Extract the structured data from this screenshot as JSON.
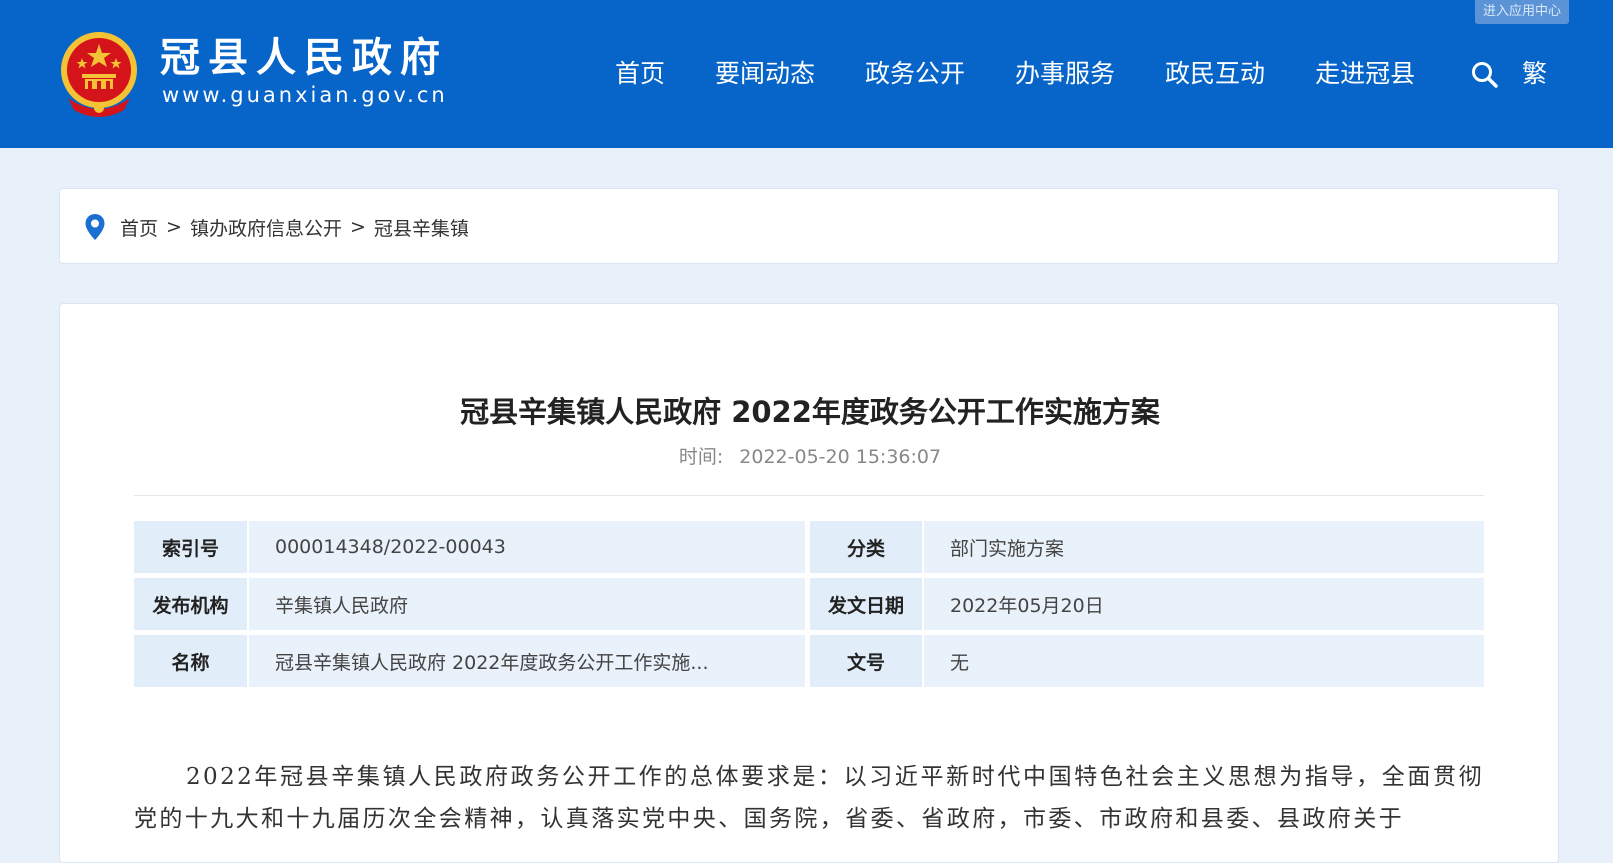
{
  "header": {
    "app_center_label": "进入应用中心",
    "site_title": "冠县人民政府",
    "site_url": "www.guanxian.gov.cn",
    "nav": [
      "首页",
      "要闻动态",
      "政务公开",
      "办事服务",
      "政民互动",
      "走进冠县"
    ],
    "trad_label": "繁",
    "colors": {
      "brand_blue": "#0764c8",
      "emblem_red": "#d4131a",
      "emblem_gold": "#f3c335"
    }
  },
  "breadcrumb": {
    "icon": "location-pin-icon",
    "items": [
      "首页",
      "镇办政府信息公开",
      "冠县辛集镇"
    ],
    "separator": ">"
  },
  "article": {
    "title": "冠县辛集镇人民政府 2022年度政务公开工作实施方案",
    "time_label": "时间:",
    "time_value": "2022-05-20 15:36:07",
    "info": {
      "index_label": "索引号",
      "index_value": "000014348/2022-00043",
      "category_label": "分类",
      "category_value": "部门实施方案",
      "publisher_label": "发布机构",
      "publisher_value": "辛集镇人民政府",
      "date_label": "发文日期",
      "date_value": "2022年05月20日",
      "name_label": "名称",
      "name_value": "冠县辛集镇人民政府 2022年度政务公开工作实施...",
      "docno_label": "文号",
      "docno_value": "无"
    },
    "body": "2022年冠县辛集镇人民政府政务公开工作的总体要求是：以习近平新时代中国特色社会主义思想为指导，全面贯彻党的十九大和十九届历次全会精神，认真落实党中央、国务院，省委、省政府，市委、市政府和县委、县政府关于"
  }
}
